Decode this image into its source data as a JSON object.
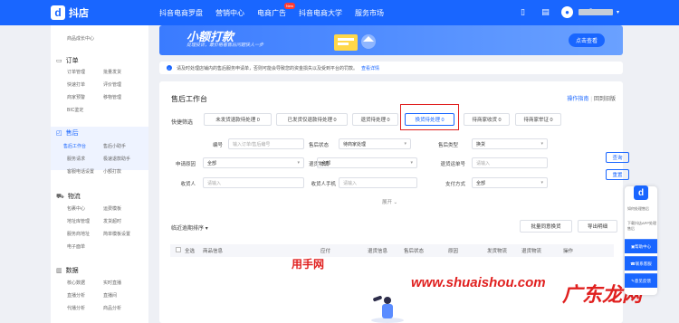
{
  "topbar": {
    "logo_text": "抖店",
    "nav": [
      "抖音电商罗盘",
      "营销中心",
      "电商广告",
      "抖音电商大学",
      "服务市场"
    ],
    "new_badge": "New"
  },
  "sidebar": {
    "top_sub": "商品成长中心",
    "groups": [
      {
        "label": "订单",
        "items": [
          "订单管理",
          "批量发货",
          "快速打单",
          "评价管理",
          "商家预警",
          "移物管理",
          "BIC鉴定"
        ]
      },
      {
        "label": "售后",
        "items": [
          "售后工作台",
          "售后小助手",
          "服务请求",
          "极速退款助手",
          "客服电话设置",
          "小额打款"
        ]
      },
      {
        "label": "物流",
        "items": [
          "包裹中心",
          "运费模板",
          "地址库管理",
          "发货超时",
          "服务商地址",
          "简单模板设置",
          "电子面单"
        ]
      },
      {
        "label": "数据",
        "items": [
          "核心数据",
          "实时直播",
          "直播分析",
          "直播间",
          "代播分析",
          "商品分析"
        ]
      }
    ]
  },
  "banner": {
    "title": "小额打款",
    "subtitle": "处理投诉，最价格看售后问题快人一步",
    "button": "点击查看"
  },
  "notice": {
    "text": "请及时处理店铺内的售后服务申请单，否则可能会导致您的资金损失以及受到平台的罚款。",
    "link": "查看详情"
  },
  "workbench": {
    "title": "售后工作台",
    "guide_link": "操作指南",
    "back_link": "回到旧版",
    "quick_filter_label": "快捷筛选",
    "chips": [
      "未发货退款待处理 0",
      "已发货仅退款待处理 0",
      "退货待处理 0",
      "换货待处理 0",
      "待商家收货 0",
      "待商家举证 0"
    ],
    "fields": {
      "order_no": {
        "label": "编号",
        "placeholder": "输入订单/售后编号"
      },
      "aftersale_status": {
        "label": "售后状态",
        "value": "待商家处理"
      },
      "aftersale_type": {
        "label": "售后类型",
        "value": "换货"
      },
      "apply_reason": {
        "label": "申请原因",
        "value": "全部"
      },
      "return_logistics": {
        "label": "退货物流",
        "value": "全部"
      },
      "return_tracking": {
        "label": "退货运单号",
        "placeholder": "请输入"
      },
      "receiver": {
        "label": "收货人",
        "placeholder": "请输入"
      },
      "receiver_phone": {
        "label": "收货人手机",
        "placeholder": "请输入"
      },
      "pay_method": {
        "label": "支付方式",
        "value": "全部"
      }
    },
    "query_button": "查询",
    "reset_button": "重置",
    "collapse": "展开",
    "sort": "临近逾期排序",
    "batch_button": "批量同意换货",
    "export_button": "导出明细",
    "columns": [
      "全选",
      "商品信息",
      "应付",
      "退货信息",
      "售后状态",
      "原因",
      "发货物流",
      "退货物流",
      "操作"
    ]
  },
  "watermarks": {
    "w1": "用手网",
    "w2": "www.shuaishou.com",
    "w3": "广东龙网"
  },
  "float_panel": {
    "text1": "如何处理售后",
    "text2": "下载抖店APP处理售后",
    "buttons": [
      "帮助中心",
      "联系客服",
      "意见反馈"
    ]
  }
}
